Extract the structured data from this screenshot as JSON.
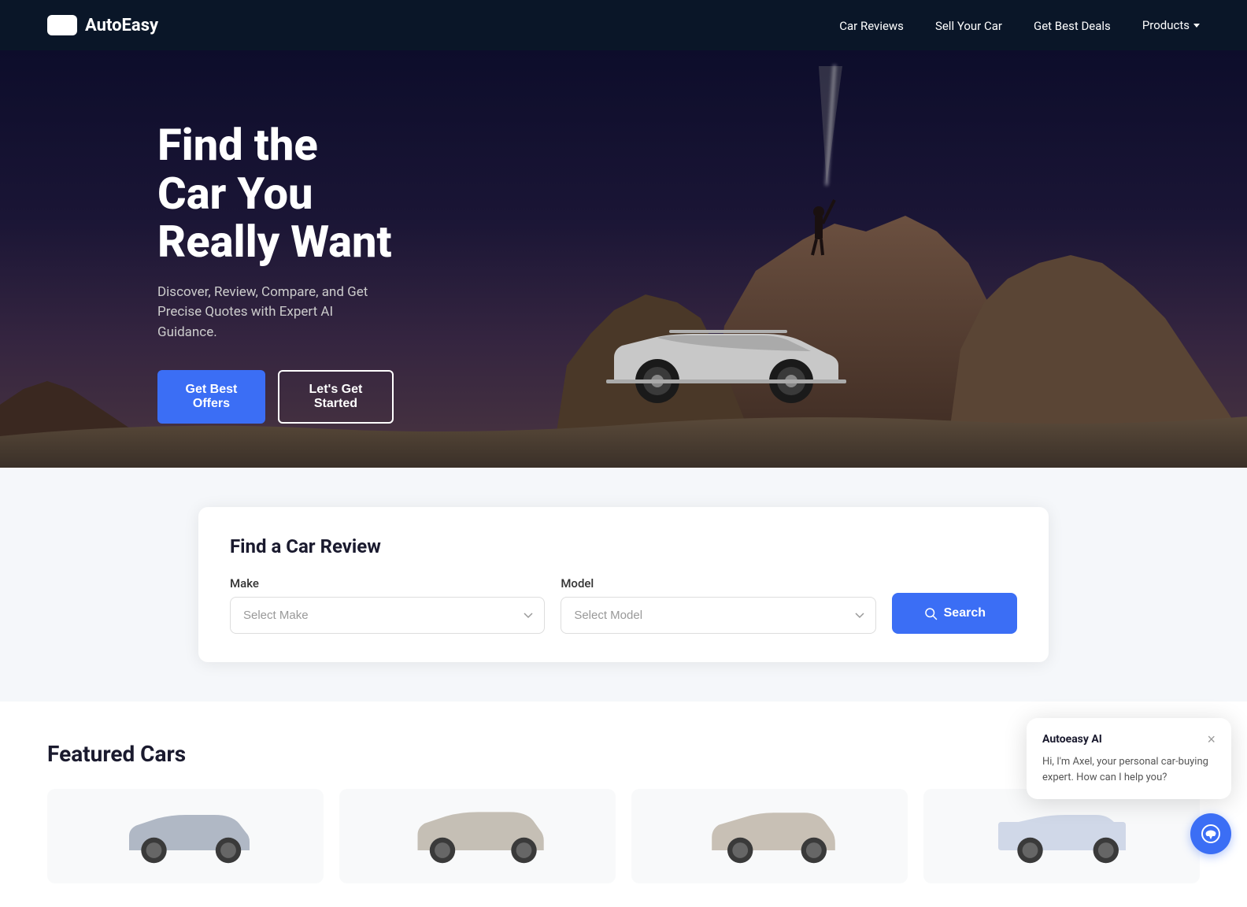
{
  "nav": {
    "brand": "AutoEasy",
    "logo_text": "□□",
    "links": [
      {
        "label": "Car Reviews",
        "href": "#"
      },
      {
        "label": "Sell Your Car",
        "href": "#"
      },
      {
        "label": "Get Best Deals",
        "href": "#"
      },
      {
        "label": "Products",
        "href": "#",
        "hasDropdown": true
      }
    ]
  },
  "hero": {
    "title_line1": "Find the Car You",
    "title_line2": "Really Want",
    "subtitle": "Discover, Review, Compare, and Get Precise Quotes with Expert AI Guidance.",
    "cta_primary": "Get Best Offers",
    "cta_secondary": "Let's Get Started"
  },
  "search": {
    "card_title": "Find a Car Review",
    "make_label": "Make",
    "make_placeholder": "Select Make",
    "model_label": "Model",
    "model_placeholder": "Select Model",
    "search_button": "Search"
  },
  "featured": {
    "section_title": "Featured Cars"
  },
  "chat": {
    "title": "Autoeasy AI",
    "message": "Hi, I'm Axel, your personal car-buying expert.  How can I help you?",
    "close_label": "×"
  }
}
